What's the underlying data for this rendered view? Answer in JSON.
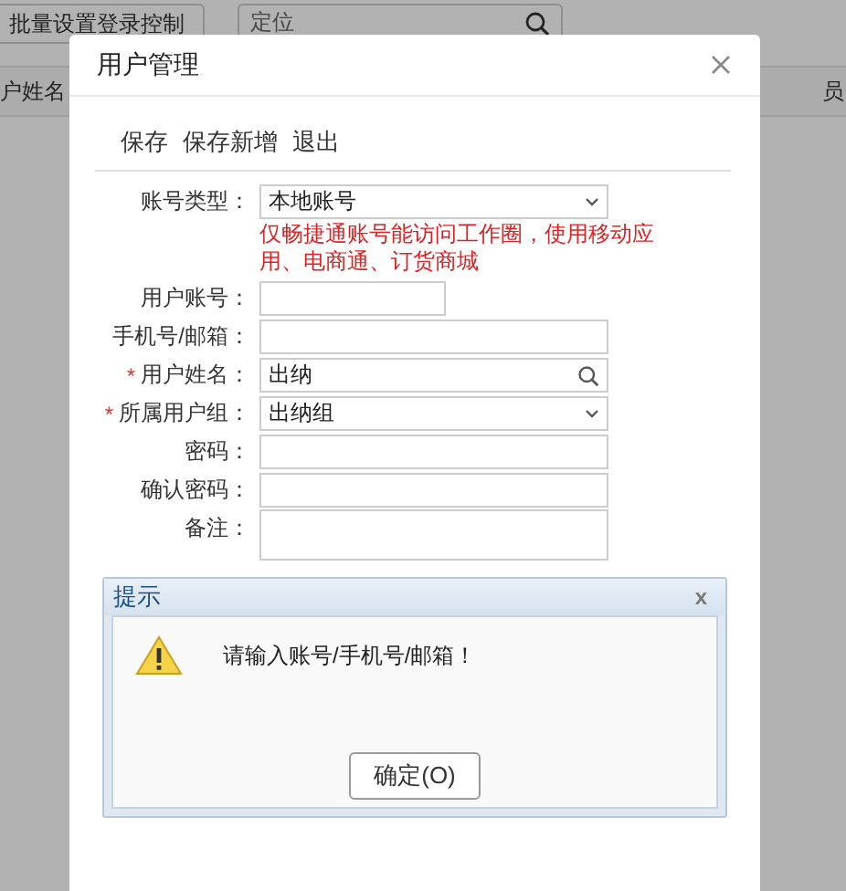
{
  "page": {
    "toolbar_button": "批量设置登录控制",
    "search": {
      "placeholder": "定位"
    },
    "table": {
      "columns": [
        "户姓名",
        "员"
      ]
    }
  },
  "modal": {
    "title": "用户管理",
    "required_mark": "*",
    "actions": [
      "保存",
      "保存新增",
      "退出"
    ],
    "fields": [
      {
        "label": "账号类型：",
        "kind": "select",
        "required": false,
        "value": "本地账号",
        "note": "仅畅捷通账号能访问工作圈，使用移动应用、电商通、订货商城"
      },
      {
        "label": "用户账号：",
        "kind": "short",
        "required": false
      },
      {
        "label": "手机号/邮箱：",
        "kind": "input",
        "required": false
      },
      {
        "label": "用户姓名：",
        "kind": "search",
        "required": true,
        "value": "出纳"
      },
      {
        "label": "所属用户组：",
        "kind": "select",
        "required": true,
        "value": "出纳组"
      },
      {
        "label": "密码：",
        "kind": "input",
        "required": false
      },
      {
        "label": "确认密码：",
        "kind": "input",
        "required": false
      },
      {
        "label": "备注：",
        "kind": "textarea",
        "required": false
      }
    ]
  },
  "alert": {
    "title": "提示",
    "close": "x",
    "message": "请输入账号/手机号/邮箱！",
    "button": "确定(O)"
  }
}
